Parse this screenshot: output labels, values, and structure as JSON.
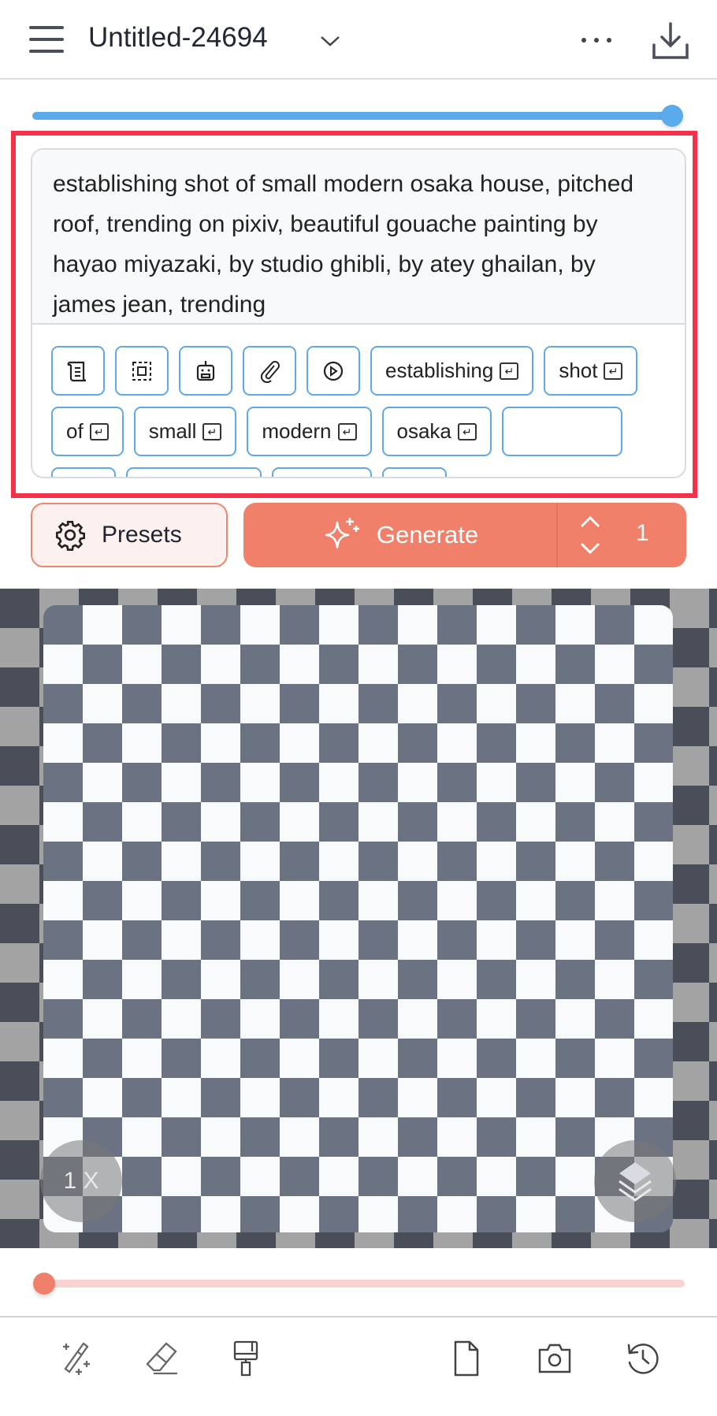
{
  "header": {
    "title": "Untitled-24694",
    "menu_icon": "hamburger-icon",
    "more_icon": "ellipsis-icon",
    "download_icon": "download-icon"
  },
  "top_slider": {
    "value_percent": 100,
    "color": "#5aabec"
  },
  "prompt": {
    "text": "establishing shot of small modern osaka house, pitched roof, trending on pixiv, beautiful gouache painting by hayao miyazaki, by studio ghibli, by atey ghailan, by james jean, trending"
  },
  "chip_icons": [
    "scroll-icon",
    "select-frame-icon",
    "robot-icon",
    "paperclip-icon",
    "play-circle-icon"
  ],
  "chips": [
    "establishing",
    "shot",
    "of",
    "small",
    "modern",
    "osaka"
  ],
  "presets": {
    "label": "Presets"
  },
  "generate": {
    "label": "Generate",
    "count": "1",
    "color": "#f0806a"
  },
  "canvas": {
    "zoom_label": "1 X"
  },
  "bottom_slider": {
    "value_percent": 0,
    "color": "#f0806a"
  },
  "toolbar": [
    "magic-wand-icon",
    "eraser-icon",
    "paint-brush-icon",
    "file-icon",
    "camera-icon",
    "history-icon"
  ]
}
